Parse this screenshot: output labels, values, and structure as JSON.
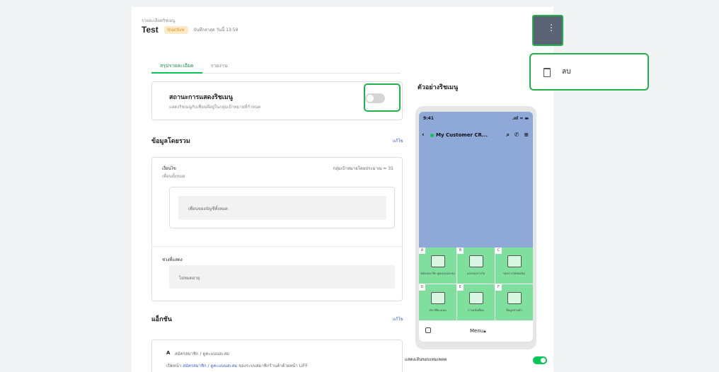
{
  "header": {
    "breadcrumb": "รายละเอียดริชเมนู",
    "title": "Test",
    "status_badge": "Inactive",
    "last_saved": "บันทึกล่าสุด วันนี้ 13:59"
  },
  "tabs": [
    {
      "label": "สรุปรายละเอียด",
      "active": true
    },
    {
      "label": "รายงาน",
      "active": false
    }
  ],
  "display_status": {
    "title": "สถานะการแสดงริชเมนู",
    "subtitle": "แสดงริชเมนูกับเพื่อนที่อยู่ในกลุ่มเป้าหมายที่กำหนด",
    "enabled": false
  },
  "overview": {
    "title": "ข้อมูลโดยรวม",
    "edit_label": "แก้ไข",
    "condition_label": "เงื่อนไข",
    "condition_value": "เพื่อนทั้งหมด",
    "target_estimate": "กลุ่มเป้าหมายโดยประมาณ ≈ 31",
    "audience_placeholder": "เพื่อนของบัญชีทั้งหมด",
    "period_label": "ช่วงที่แสดง",
    "period_value": "ไม่หมดอายุ"
  },
  "actions": {
    "title": "แอ็กชัน",
    "edit_label": "แก้ไข",
    "first_letter": "A",
    "first_label": "สมัครสมาชิก / ดูคะแนนสะสม",
    "first_desc_prefix": "เปิดหน้า",
    "first_desc_link": "สมัครสมาชิก / ดูคะแนนสะสม",
    "first_desc_suffix": "ของระบบสมาชิกร้านค้าด้วยหน้า LIFF"
  },
  "preview": {
    "title": "ตัวอย่างริชเมนู",
    "status_time": "9:41",
    "status_icons": ".ııl ≈ ▬",
    "back_icon": "‹",
    "chat_name": "My Customer CR...",
    "chat_icons": "⌕ ✆ ≡",
    "menu_label": "Menu▴",
    "cells": [
      {
        "letter": "A",
        "label": "สมัครสมาชิก ดูคะแนนสะสม",
        "icon": "member-card-icon"
      },
      {
        "letter": "B",
        "label": "แลกของรางวัล",
        "icon": "gift-icon"
      },
      {
        "letter": "C",
        "label": "ของรางวัลของฉัน",
        "icon": "reward-icon"
      },
      {
        "letter": "D",
        "label": "ประวัติคะแนน",
        "icon": "coin-icon"
      },
      {
        "letter": "E",
        "label": "การแจ้งเตือน",
        "icon": "bell-icon"
      },
      {
        "letter": "F",
        "label": "ข้อมูลส่วนตัว",
        "icon": "profile-card-icon"
      }
    ],
    "template_border_label": "แสดงเส้นขอบเทมเพลต",
    "template_border_enabled": true
  },
  "more_menu": {
    "kebab_icon": "⋮",
    "delete_label": "ลบ"
  },
  "colors": {
    "accent_green": "#06c755",
    "highlight_green": "#22b24c",
    "badge_bg": "#fdeac5",
    "badge_text": "#e48a16",
    "preview_bg": "#8ea8d8",
    "menu_cell": "#7fe09e",
    "link_blue": "#3a5ad9"
  }
}
